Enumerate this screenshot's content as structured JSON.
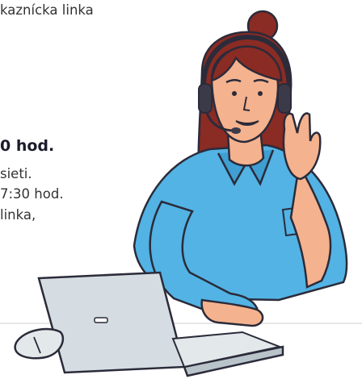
{
  "text": {
    "top_partial": "kaznícka linka",
    "bold_partial": "0 hod.",
    "line1_partial": "sieti.",
    "line2_partial": "7:30 hod.",
    "line3_partial": "linka,"
  },
  "colors": {
    "shirt": "#52b3e4",
    "shirt_shadow": "#3f9fd2",
    "skin": "#f4b28e",
    "hair": "#8a2b24",
    "laptop": "#d6dde2",
    "laptop_dark": "#b9c3ca",
    "floor_line": "#e7e7e7",
    "outline": "#2b2b3a"
  },
  "illustration": {
    "subject": "customer-support-agent",
    "icons": [
      "headset-icon",
      "laptop-icon",
      "mouse-icon"
    ]
  }
}
